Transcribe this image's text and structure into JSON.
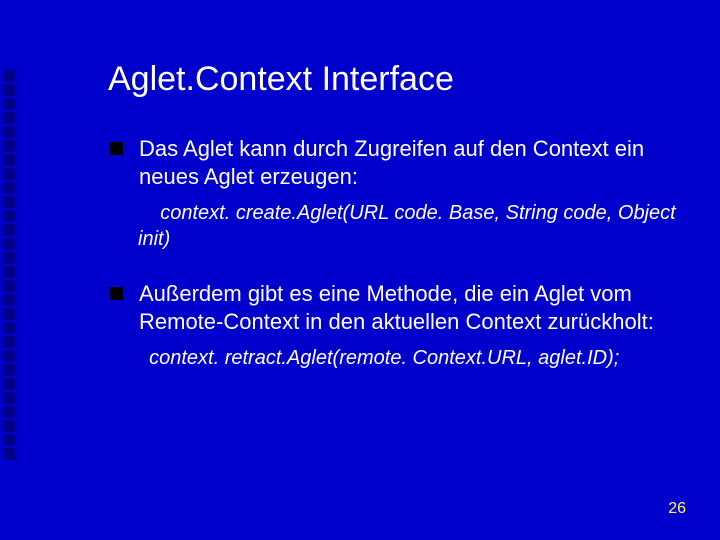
{
  "title": "Aglet.Context Interface",
  "bullets": [
    {
      "text": "Das Aglet kann durch Zugreifen auf den Context ein  neues Aglet erzeugen:",
      "code": "    context. create.Aglet(URL  code. Base,  String  code, Object init)"
    },
    {
      "text": "Außerdem gibt es eine Methode, die ein Aglet vom Remote-Context in den aktuellen Context zurückholt:",
      "code": "  context. retract.Aglet(remote. Context.URL, aglet.ID);"
    }
  ],
  "page_number": "26"
}
